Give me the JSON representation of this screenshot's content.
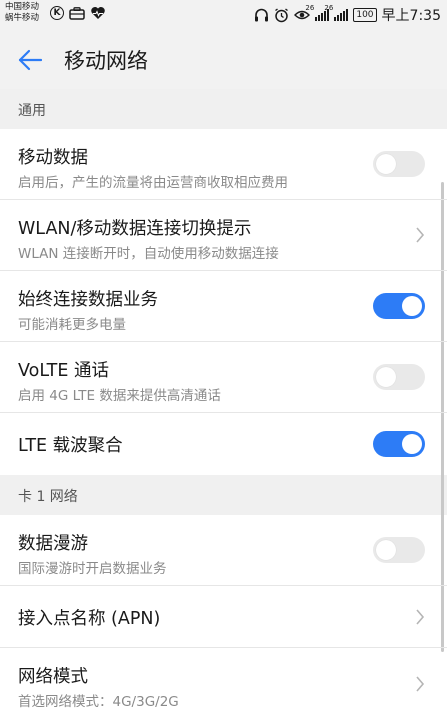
{
  "status_bar": {
    "carrier_line1": "中国移动",
    "carrier_line2": "蜗牛移动",
    "signal1_label": "26",
    "signal2_label": "26",
    "battery": "100",
    "time": "早上7:35"
  },
  "app_bar": {
    "title": "移动网络"
  },
  "sections": {
    "general": {
      "header": "通用",
      "rows": [
        {
          "title": "移动数据",
          "subtitle": "启用后，产生的流量将由运营商收取相应费用",
          "toggle": "off"
        },
        {
          "title": "WLAN/移动数据连接切换提示",
          "subtitle": "WLAN 连接断开时，自动使用移动数据连接",
          "chevron": true
        },
        {
          "title": "始终连接数据业务",
          "subtitle": "可能消耗更多电量",
          "toggle": "on"
        },
        {
          "title": "VoLTE 通话",
          "subtitle": "启用 4G LTE 数据来提供高清通话",
          "toggle": "off"
        },
        {
          "title": "LTE 载波聚合",
          "toggle": "on"
        }
      ]
    },
    "card1": {
      "header": "卡 1 网络",
      "rows": [
        {
          "title": "数据漫游",
          "subtitle": "国际漫游时开启数据业务",
          "toggle": "off"
        },
        {
          "title": "接入点名称 (APN)",
          "chevron": true
        },
        {
          "title": "网络模式",
          "subtitle": "首选网络模式：4G/3G/2G",
          "chevron": true
        }
      ]
    }
  },
  "colors": {
    "accent": "#2d7cf6",
    "toggle_off": "#e9e9e9",
    "header_bg": "#f2f2f2"
  }
}
